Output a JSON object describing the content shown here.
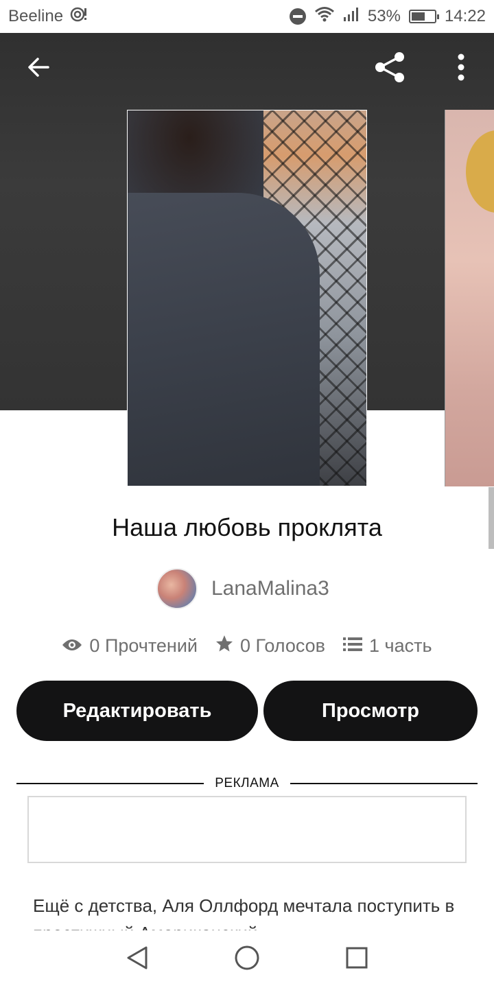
{
  "status_bar": {
    "carrier": "Beeline",
    "battery_percent": "53%",
    "battery_level": 0.53,
    "time": "14:22",
    "icons": [
      "hotspot-icon",
      "dnd-icon",
      "wifi-icon",
      "signal-icon",
      "battery-icon"
    ]
  },
  "toolbar": {
    "back_icon": "arrow-left-icon",
    "share_icon": "share-icon",
    "more_icon": "more-vertical-icon"
  },
  "story": {
    "title": "Наша любовь проклята",
    "author": "LanaMalina3",
    "stats": {
      "reads": "0 Прочтений",
      "votes": "0 Голосов",
      "parts": "1 часть"
    },
    "description": "Ещё с детства, Аля Оллфорд мечтала поступить в престижный Американский"
  },
  "actions": {
    "edit_label": "Редактировать",
    "view_label": "Просмотр"
  },
  "ad": {
    "label": "РЕКЛАМА"
  },
  "nav": {
    "icons": [
      "back-triangle-icon",
      "home-circle-icon",
      "recents-square-icon"
    ]
  },
  "colors": {
    "header_bg": "#333333",
    "button_bg": "#131314",
    "muted_text": "#6f6f6f"
  }
}
